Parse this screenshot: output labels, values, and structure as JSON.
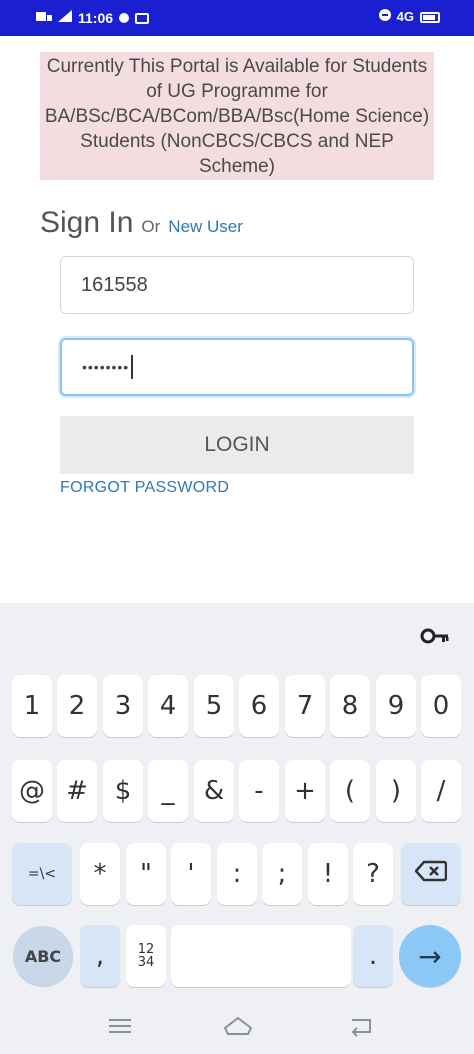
{
  "status_bar": {
    "time": "11:06",
    "network_label": "4G",
    "left_icons": [
      "sim-icon",
      "signal-icon",
      "app-dot-icon",
      "notification-icon"
    ],
    "right_icons": [
      "dnd-icon",
      "network-icon",
      "battery-icon"
    ]
  },
  "notice": {
    "text": "Currently This Portal is Available for Students of UG Programme for BA/BSc/BCA/BCom/BBA/Bsc(Home Science) Students (NonCBCS/CBCS and NEP Scheme)",
    "background": "#f3dde0"
  },
  "signin": {
    "title": "Sign In",
    "or": "Or",
    "new_user": "New User"
  },
  "form": {
    "username_value": "161558",
    "password_value": "••••••••",
    "login_label": "LOGIN",
    "forgot_label": "FORGOT PASSWORD"
  },
  "keyboard": {
    "row1": [
      "1",
      "2",
      "3",
      "4",
      "5",
      "6",
      "7",
      "8",
      "9",
      "0"
    ],
    "row2": [
      "@",
      "#",
      "$",
      "_",
      "&",
      "-",
      "+",
      "(",
      ")",
      "/"
    ],
    "row3": [
      "=\\<",
      "*",
      "\"",
      "'",
      ":",
      ";",
      "!",
      "?",
      "⌫"
    ],
    "row4": {
      "abc": "ABC",
      "comma": ",",
      "numgrid_top": "12",
      "numgrid_bottom": "34",
      "period": ".",
      "enter": "→"
    },
    "top_icon": "key-icon"
  },
  "colors": {
    "status_bar": "#1a1fd0",
    "link": "#2f79b5",
    "focus": "#8fc2ee",
    "enter_key": "#8cc8f5"
  },
  "navbar": {
    "icons": [
      "menu-icon",
      "home-icon",
      "back-icon"
    ]
  }
}
